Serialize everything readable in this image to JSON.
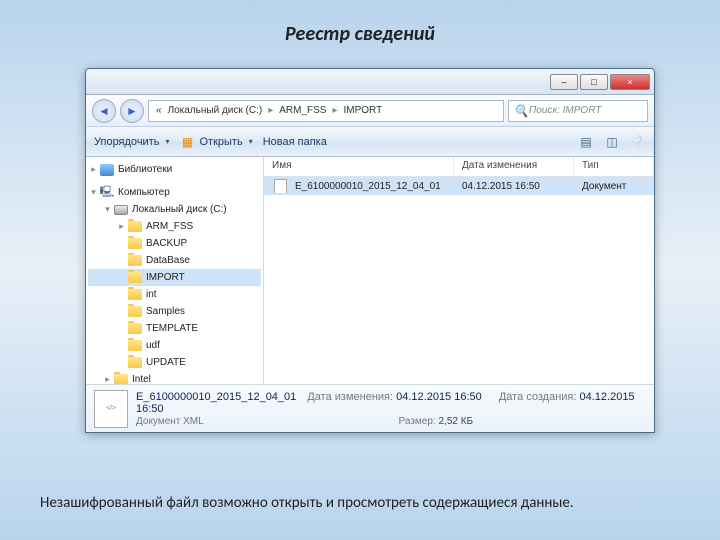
{
  "slide": {
    "title": "Реестр сведений"
  },
  "window_controls": {
    "min": "–",
    "max": "□",
    "close": "×"
  },
  "breadcrumb": {
    "prefix": "«",
    "part1": "Локальный диск (C:)",
    "part2": "ARM_FSS",
    "part3": "IMPORT"
  },
  "search": {
    "placeholder": "Поиск: IMPORT"
  },
  "toolbar": {
    "organize": "Упорядочить",
    "open": "Открыть",
    "newfolder": "Новая папка"
  },
  "tree": {
    "libraries": "Библиотеки",
    "computer": "Компьютер",
    "drive": "Локальный диск (C:)",
    "folders": [
      "ARM_FSS",
      "BACKUP",
      "DataBase",
      "IMPORT",
      "int",
      "Samples",
      "TEMPLATE",
      "udf",
      "UPDATE",
      "Intel"
    ]
  },
  "filelist": {
    "headers": {
      "name": "Имя",
      "date": "Дата изменения",
      "type": "Тип"
    },
    "rows": [
      {
        "name": "E_6100000010_2015_12_04_01",
        "date": "04.12.2015 16:50",
        "type": "Документ"
      }
    ]
  },
  "details": {
    "name": "E_6100000010_2015_12_04_01",
    "type_label": "Документ XML",
    "modified_label": "Дата изменения:",
    "modified_value": "04.12.2015 16:50",
    "size_label": "Размер:",
    "size_value": "2,52 КБ",
    "created_label": "Дата создания:",
    "created_value": "04.12.2015 16:50"
  },
  "caption": "Незашифрованный файл возможно открыть и просмотреть содержащиеся данные."
}
